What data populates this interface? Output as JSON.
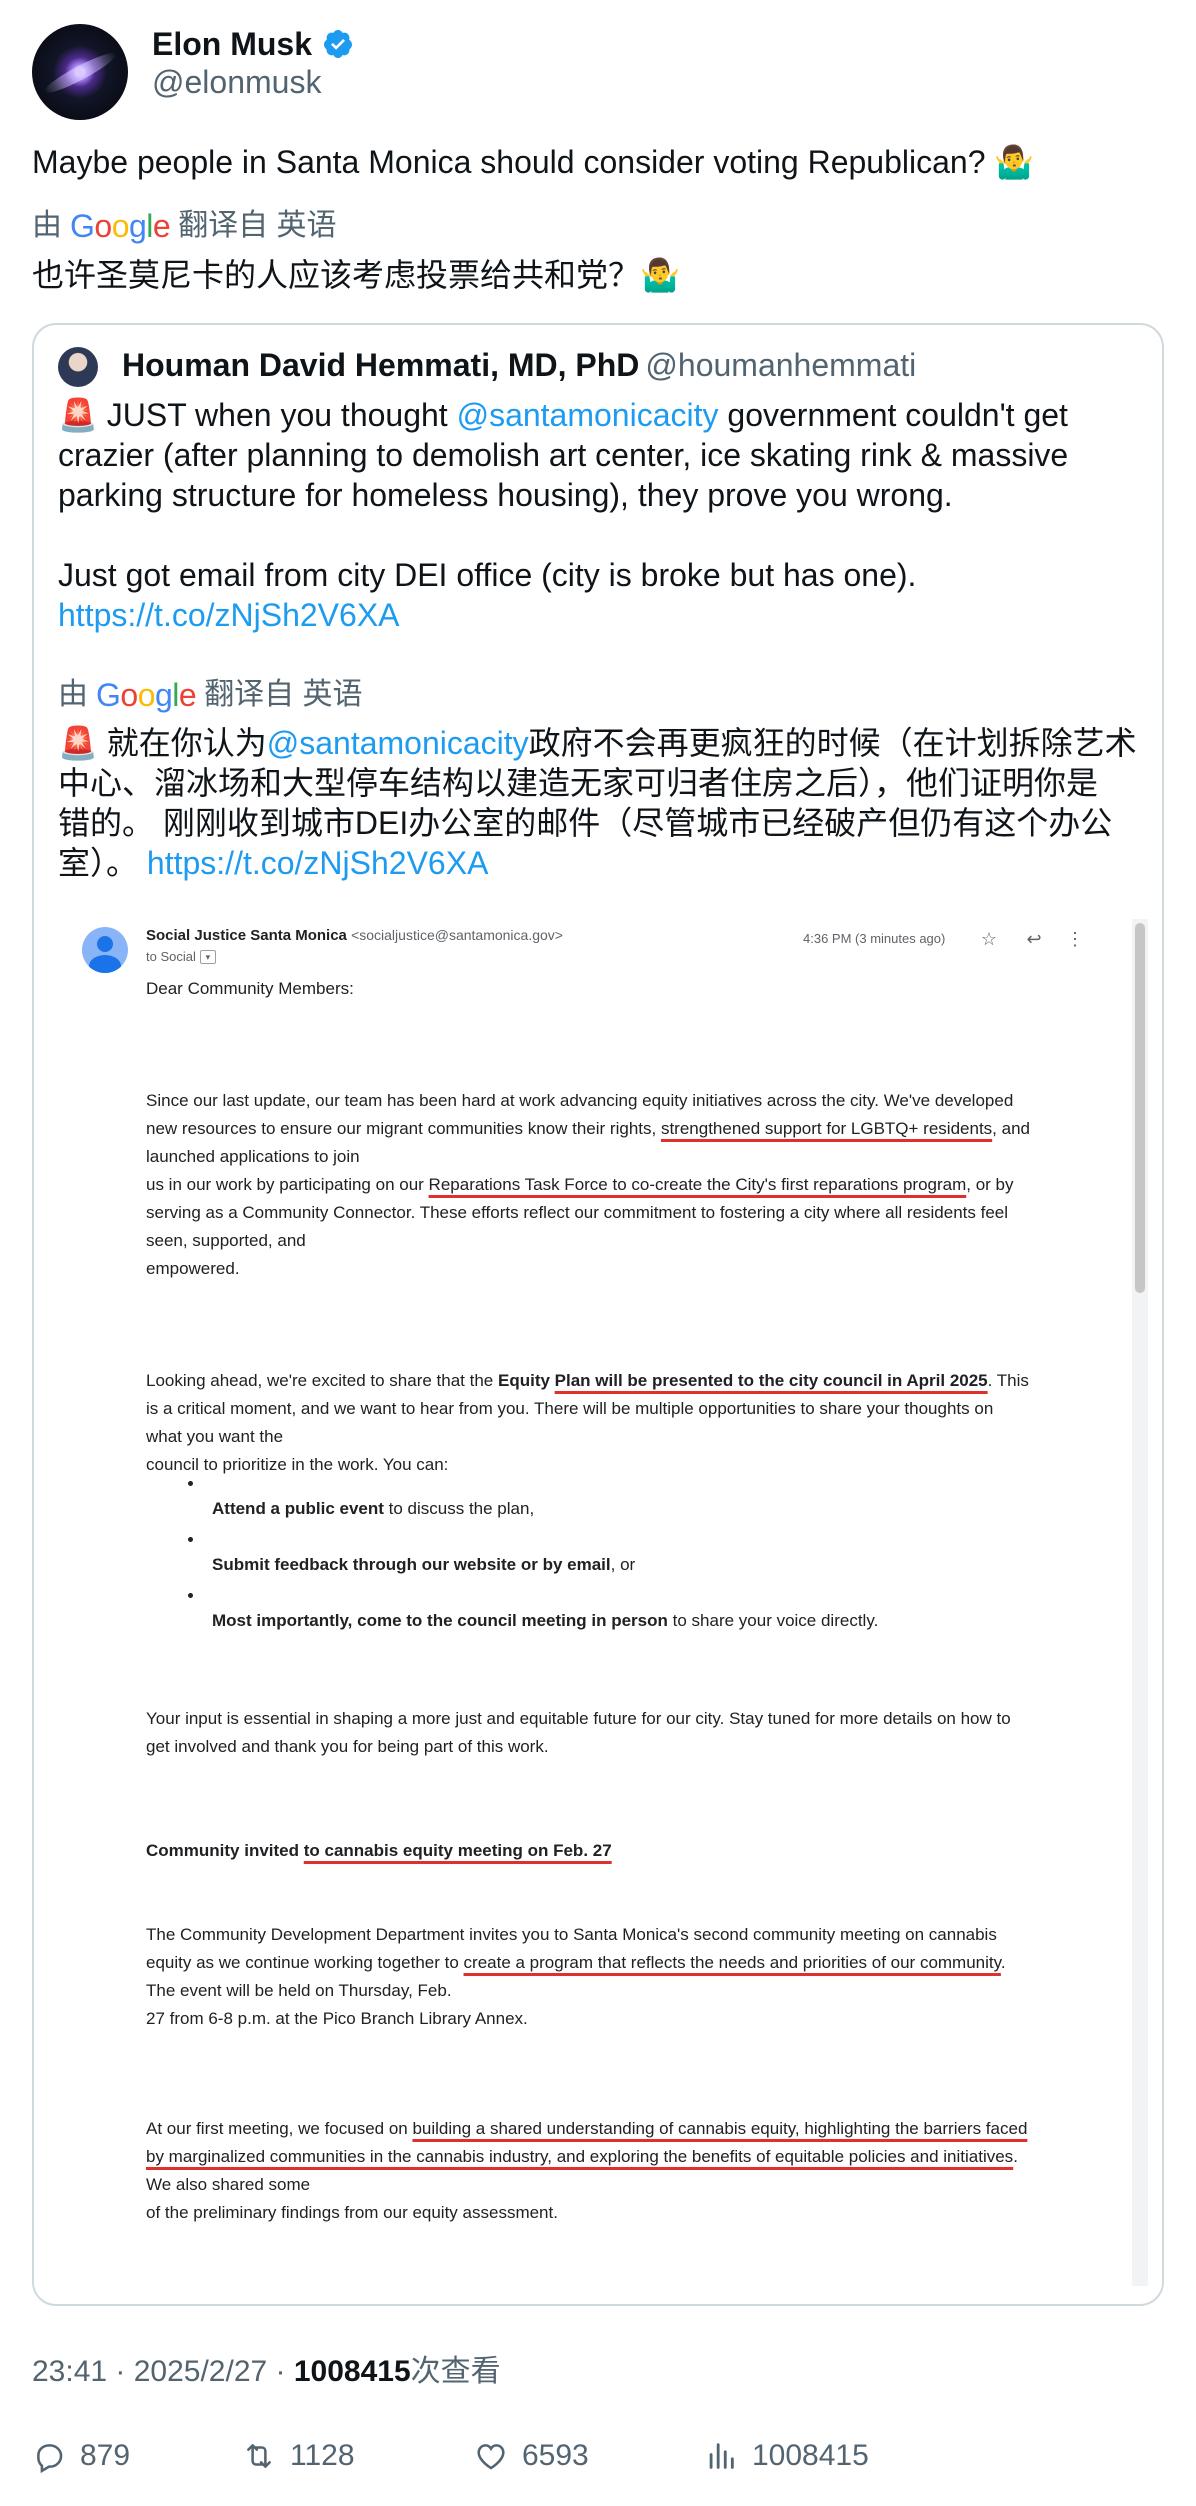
{
  "author": {
    "name": "Elon Musk",
    "handle": "@elonmusk"
  },
  "tweet": {
    "text": "Maybe people in Santa Monica should consider voting Republican? 🤷‍♂️",
    "translate_prefix": "由",
    "translate_suffix": "翻译自 英语",
    "translated_text": "也许圣莫尼卡的人应该考虑投票给共和党？🤷‍♂️"
  },
  "google_logo": [
    "G",
    "o",
    "o",
    "g",
    "l",
    "e"
  ],
  "quote": {
    "author_name": "Houman David Hemmati, MD, PhD",
    "author_handle": "@houmanhemmati",
    "body_line1_pre": "🚨 JUST when you thought ",
    "body_mention": "@santamonicacity",
    "body_line1_post": " government couldn't get",
    "body_line2": "crazier (after planning to demolish art center, ice skating rink & massive",
    "body_line3": "parking structure for homeless housing), they prove you wrong.",
    "body_line4": "Just got email from city DEI office (city is broke but has one).",
    "body_link": "https://t.co/zNjSh2V6XA",
    "translate_prefix": "由",
    "translate_suffix": "翻译自 英语",
    "trans_line1_pre": "🚨 就在你认为",
    "trans_mention": "@santamonicacity",
    "trans_line1_post": "政府不会再更疯狂的时候（在计划拆除艺术",
    "trans_line2": "中心、溜冰场和大型停车结构以建造无家可归者住房之后），他们证明你是",
    "trans_line3": "错的。 刚刚收到城市DEI办公室的邮件（尽管城市已经破产但仍有这个办公",
    "trans_line4_pre": "室）。",
    "trans_link": "https://t.co/zNjSh2V6XA"
  },
  "email": {
    "sender_name": "Social Justice Santa Monica",
    "sender_email": "<socialjustice@santamonica.gov>",
    "to": "to Social",
    "time": "4:36 PM (3 minutes ago)",
    "greeting": "Dear Community Members:",
    "p1_l1": "Since our last update, our team has been hard at work advancing equity initiatives across the city. We've developed",
    "p1_l2_pre": "new resources to ensure our migrant communities know their rights, ",
    "p1_l2_ul": "strengthened support for LGBTQ+ residents",
    "p1_l2_post": ", and",
    "p1_l3": "launched applications to join",
    "p1_l4_pre": " us in our work by participating on our ",
    "p1_l4_ul": "Reparations Task Force to co-create the City's first reparations program",
    "p1_l4_post": ", or by",
    "p1_l5": "serving as a Community Connector. These efforts reflect our commitment to fostering a city where all residents feel",
    "p1_l6": "seen, supported, and",
    "p1_l7": " empowered.",
    "p2_l1_pre": "Looking ahead, we're excited to share that the ",
    "p2_l1_b1": "Equity ",
    "p2_l1_ul": "Plan will be presented to the city council in April 2025",
    "p2_l1_post": ". This",
    "p2_l2": "is a critical moment, and we want to hear from you. There will be multiple opportunities to share your thoughts on",
    "p2_l3": "what you want the",
    "p2_l4": " council to prioritize in the work. You can:",
    "b1_bold": "Attend a public event",
    "b1_rest": " to discuss the plan,",
    "b2_bold": "Submit feedback through our website or by email",
    "b2_rest": ", or",
    "b3_bold": "Most importantly, come to the council meeting in person",
    "b3_rest": " to share your voice directly.",
    "p3_l1": "Your input is essential in shaping a more just and equitable future for our city. Stay tuned for more details on how to",
    "p3_l2": "get involved and thank you for being part of this work.",
    "h_pre": "Community invited ",
    "h_ul": "to cannabis equity meeting on Feb. 27",
    "p4_l1": "The Community Development Department invites you to Santa Monica's second community meeting on cannabis",
    "p4_l2_pre": "equity as we continue working together to ",
    "p4_l2_ul": "create a program that reflects the needs and priorities of our community",
    "p4_l2_post": ".",
    "p4_l3": "The event will be held on Thursday, Feb.",
    "p4_l4": " 27 from 6-8 p.m. at the Pico Branch Library Annex.",
    "p5_l1_pre": "At our first meeting, we focused on ",
    "p5_l1_ul": "building a shared understanding of cannabis equity, highlighting the barriers faced",
    "p5_l2_ul": "by marginalized communities in the cannabis industry, and exploring the benefits of equitable policies and initiatives",
    "p5_l2_post": ".",
    "p5_l3": "We also shared some",
    "p5_l4": " of the preliminary findings from our equity assessment."
  },
  "meta": {
    "time": "23:41 · 2025/2/27 · ",
    "views": "1008415",
    "views_suffix": "次查看"
  },
  "actions": {
    "replies": "879",
    "retweets": "1128",
    "likes": "6593",
    "views": "1008415"
  }
}
